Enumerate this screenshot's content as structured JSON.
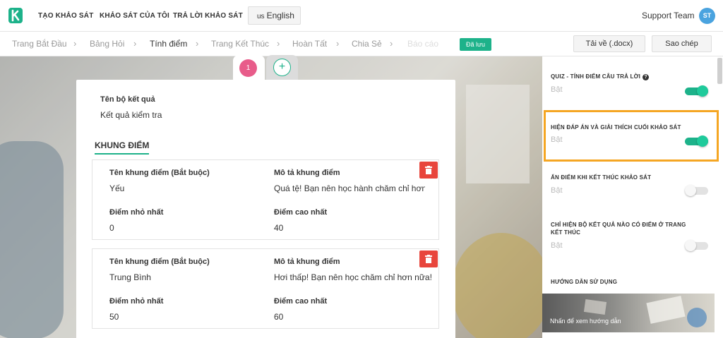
{
  "nav": {
    "links": [
      "TẠO KHẢO SÁT",
      "KHẢO SÁT CỦA TÔI",
      "TRẢ LỜI KHẢO SÁT"
    ],
    "language": {
      "flag": "us",
      "label": "English"
    },
    "support_label": "Support Team",
    "avatar_initials": "ST"
  },
  "steps": {
    "items": [
      "Trang Bắt Đầu",
      "Bảng Hỏi",
      "Tính điểm",
      "Trang Kết Thúc",
      "Hoàn Tất",
      "Chia Sẻ",
      "Báo cáo"
    ],
    "active_index": 2,
    "saved_badge": "Đã lưu",
    "download_label": "Tải về (.docx)",
    "copy_label": "Sao chép"
  },
  "page_tabs": {
    "current": "1",
    "add_symbol": "+"
  },
  "result_set": {
    "name_label": "Tên bộ kết quả",
    "name_value": "Kết quả kiểm tra",
    "section_title": "KHUNG ĐIỂM",
    "ranges": [
      {
        "name_label": "Tên khung điểm (Bắt buộc)",
        "name": "Yếu",
        "desc_label": "Mô tả khung điểm",
        "desc": "Quá tệ! Bạn nên học hành chăm chỉ hơn nữa!",
        "min_label": "Điểm nhỏ nhất",
        "min": "0",
        "max_label": "Điểm cao nhất",
        "max": "40"
      },
      {
        "name_label": "Tên khung điểm (Bắt buộc)",
        "name": "Trung Bình",
        "desc_label": "Mô tả khung điểm",
        "desc": "Hơi thấp! Bạn nên học chăm chỉ hơn nữa!",
        "min_label": "Điểm nhỏ nhất",
        "min": "50",
        "max_label": "Điểm cao nhất",
        "max": "60"
      }
    ]
  },
  "settings": [
    {
      "title": "QUIZ - TÍNH ĐIỂM CÂU TRẢ LỜI",
      "state": "Bật",
      "on": true
    },
    {
      "title": "HIỆN ĐÁP ÁN VÀ GIẢI THÍCH CUỐI KHẢO SÁT",
      "state": "Bật",
      "on": true
    },
    {
      "title": "ẨN ĐIỂM KHI KẾT THÚC KHẢO SÁT",
      "state": "Bật",
      "on": false
    },
    {
      "title": "CHỈ HIỆN BỘ KẾT QUẢ NÀO CÓ ĐIỂM Ở TRANG KẾT THÚC",
      "state": "Bật",
      "on": false
    }
  ],
  "guide": {
    "title": "HƯỚNG DẪN SỬ DỤNG",
    "banner_text": "Nhấn để xem hướng dẫn"
  },
  "colors": {
    "accent": "#1db28a",
    "highlight": "#f5a623",
    "delete": "#e8453c",
    "page_badge": "#e85c8a"
  }
}
